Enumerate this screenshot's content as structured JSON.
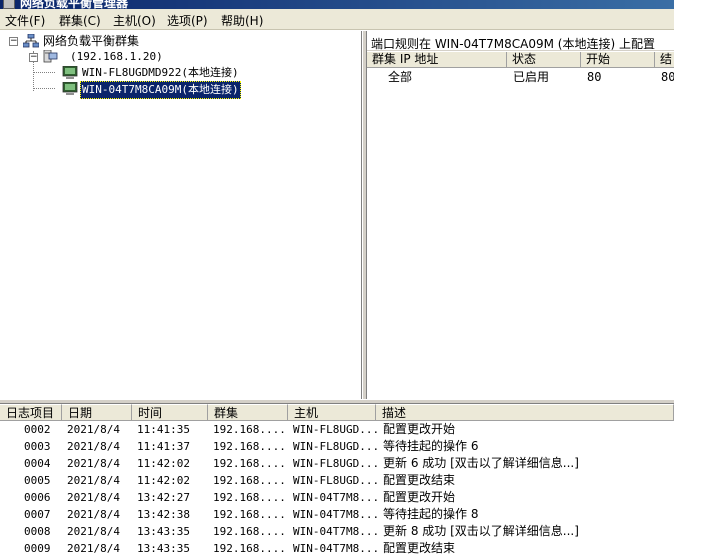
{
  "window": {
    "title": "网络负载平衡管理器"
  },
  "menu": [
    {
      "label": "文件(F)"
    },
    {
      "label": "群集(C)"
    },
    {
      "label": "主机(O)"
    },
    {
      "label": "选项(P)"
    },
    {
      "label": "帮助(H)"
    }
  ],
  "tree": {
    "root": "网络负载平衡群集",
    "cluster": "(192.168.1.20)",
    "hosts": [
      {
        "label": "WIN-FL8UGDMD922(本地连接)",
        "selected": false
      },
      {
        "label": "WIN-04T7M8CA09M(本地连接)",
        "selected": true
      }
    ]
  },
  "port_rules": {
    "heading": "端口规则在 WIN-04T7M8CA09M (本地连接) 上配置",
    "columns": [
      "群集 IP 地址",
      "状态",
      "开始",
      "结"
    ],
    "rows": [
      {
        "ip": "全部",
        "status": "已启用",
        "start": "80",
        "end": "80"
      }
    ]
  },
  "log": {
    "columns": [
      "日志项目",
      "日期",
      "时间",
      "群集",
      "主机",
      "描述"
    ],
    "rows": [
      {
        "id": "0002",
        "date": "2021/8/4",
        "time": "11:41:35",
        "cluster": "192.168....",
        "host": "WIN-FL8UGD...",
        "desc": "配置更改开始"
      },
      {
        "id": "0003",
        "date": "2021/8/4",
        "time": "11:41:37",
        "cluster": "192.168....",
        "host": "WIN-FL8UGD...",
        "desc": "等待挂起的操作 6"
      },
      {
        "id": "0004",
        "date": "2021/8/4",
        "time": "11:42:02",
        "cluster": "192.168....",
        "host": "WIN-FL8UGD...",
        "desc": "更新 6 成功 [双击以了解详细信息...]"
      },
      {
        "id": "0005",
        "date": "2021/8/4",
        "time": "11:42:02",
        "cluster": "192.168....",
        "host": "WIN-FL8UGD...",
        "desc": "配置更改结束"
      },
      {
        "id": "0006",
        "date": "2021/8/4",
        "time": "13:42:27",
        "cluster": "192.168....",
        "host": "WIN-04T7M8...",
        "desc": "配置更改开始"
      },
      {
        "id": "0007",
        "date": "2021/8/4",
        "time": "13:42:38",
        "cluster": "192.168....",
        "host": "WIN-04T7M8...",
        "desc": "等待挂起的操作 8"
      },
      {
        "id": "0008",
        "date": "2021/8/4",
        "time": "13:43:35",
        "cluster": "192.168....",
        "host": "WIN-04T7M8...",
        "desc": "更新 8 成功 [双击以了解详细信息...]"
      },
      {
        "id": "0009",
        "date": "2021/8/4",
        "time": "13:43:35",
        "cluster": "192.168....",
        "host": "WIN-04T7M8...",
        "desc": "配置更改结束"
      }
    ]
  },
  "colors": {
    "titlebar": "#0a246a",
    "selection": "#0a246a",
    "chrome": "#ece9d8"
  },
  "icons": {
    "cluster": "network-cluster-icon",
    "server": "server-icon",
    "host": "host-computer-icon",
    "expand": "tree-collapse-minus-icon"
  }
}
